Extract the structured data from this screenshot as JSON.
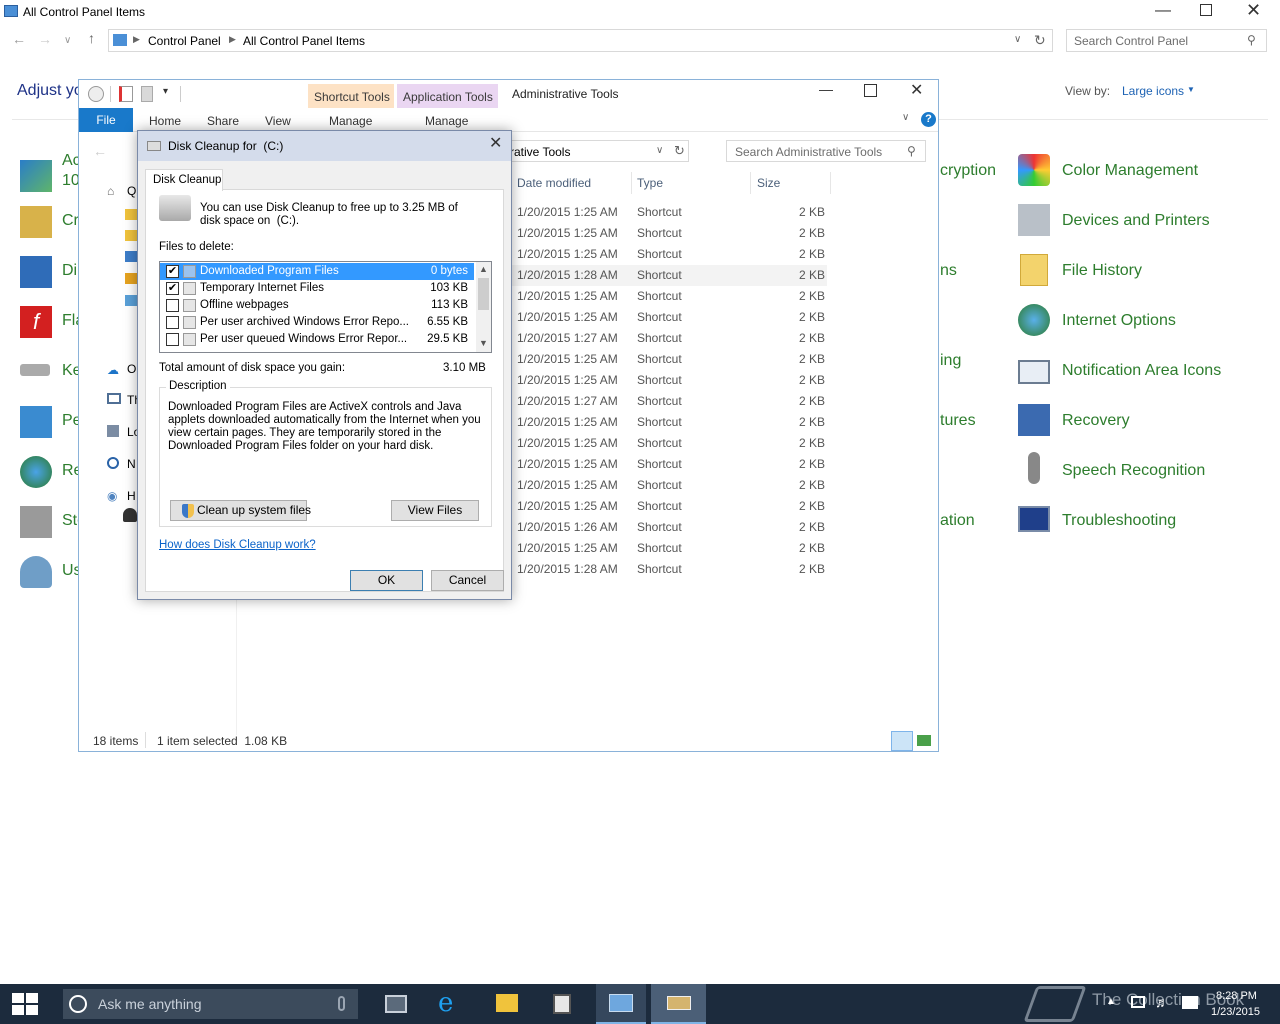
{
  "control_panel": {
    "window_title": "All Control Panel Items",
    "breadcrumb": [
      "Control Panel",
      "All Control Panel Items"
    ],
    "search_placeholder": "Search Control Panel",
    "adjust_heading": "Adjust yo",
    "view_by_label": "View by:",
    "view_by_value": "Large icons",
    "left_items": [
      "Ac",
      "10",
      "Cr",
      "Di",
      "Fla",
      "Ke",
      "Pe",
      "Re",
      "Sto",
      "Us"
    ],
    "middle_fragments": [
      "cryption",
      "ns",
      "ing",
      "tures",
      "ation"
    ],
    "right_items": [
      "Color Management",
      "Devices and Printers",
      "File History",
      "Internet Options",
      "Notification Area Icons",
      "Recovery",
      "Speech Recognition",
      "Troubleshooting"
    ]
  },
  "admin_tools": {
    "title": "Administrative Tools",
    "context_tabs": [
      {
        "group": "Shortcut Tools",
        "label": "Manage",
        "color": "#fde2c5"
      },
      {
        "group": "Application Tools",
        "label": "Manage",
        "color": "#ead6f2"
      }
    ],
    "ribbon_tabs": [
      "File",
      "Home",
      "Share",
      "View"
    ],
    "address_fragment": "rative Tools",
    "search_placeholder": "Search Administrative Tools",
    "columns": [
      "Date modified",
      "Type",
      "Size"
    ],
    "rows": [
      {
        "date": "1/20/2015 1:25 AM",
        "type": "Shortcut",
        "size": "2 KB"
      },
      {
        "date": "1/20/2015 1:25 AM",
        "type": "Shortcut",
        "size": "2 KB"
      },
      {
        "date": "1/20/2015 1:25 AM",
        "type": "Shortcut",
        "size": "2 KB"
      },
      {
        "date": "1/20/2015 1:28 AM",
        "type": "Shortcut",
        "size": "2 KB"
      },
      {
        "date": "1/20/2015 1:25 AM",
        "type": "Shortcut",
        "size": "2 KB"
      },
      {
        "date": "1/20/2015 1:25 AM",
        "type": "Shortcut",
        "size": "2 KB"
      },
      {
        "date": "1/20/2015 1:27 AM",
        "type": "Shortcut",
        "size": "2 KB"
      },
      {
        "date": "1/20/2015 1:25 AM",
        "type": "Shortcut",
        "size": "2 KB"
      },
      {
        "date": "1/20/2015 1:25 AM",
        "type": "Shortcut",
        "size": "2 KB"
      },
      {
        "date": "1/20/2015 1:27 AM",
        "type": "Shortcut",
        "size": "2 KB"
      },
      {
        "date": "1/20/2015 1:25 AM",
        "type": "Shortcut",
        "size": "2 KB"
      },
      {
        "date": "1/20/2015 1:25 AM",
        "type": "Shortcut",
        "size": "2 KB"
      },
      {
        "date": "1/20/2015 1:25 AM",
        "type": "Shortcut",
        "size": "2 KB"
      },
      {
        "date": "1/20/2015 1:25 AM",
        "type": "Shortcut",
        "size": "2 KB"
      },
      {
        "date": "1/20/2015 1:25 AM",
        "type": "Shortcut",
        "size": "2 KB"
      },
      {
        "date": "1/20/2015 1:26 AM",
        "type": "Shortcut",
        "size": "2 KB"
      },
      {
        "date": "1/20/2015 1:25 AM",
        "type": "Shortcut",
        "size": "2 KB"
      },
      {
        "date": "1/20/2015 1:28 AM",
        "type": "Shortcut",
        "size": "2 KB"
      }
    ],
    "nav_fragments": [
      "Q",
      "O",
      "Th",
      "Lo",
      "N",
      "H"
    ],
    "status_count": "18 items",
    "status_selected": "1 item selected  1.08 KB"
  },
  "disk_cleanup": {
    "title": "Disk Cleanup for  (C:)",
    "tab": "Disk Cleanup",
    "intro": "You can use Disk Cleanup to free up to 3.25 MB of disk space on  (C:).",
    "files_label": "Files to delete:",
    "files": [
      {
        "name": "Downloaded Program Files",
        "size": "0 bytes",
        "checked": true,
        "selected": true
      },
      {
        "name": "Temporary Internet Files",
        "size": "103 KB",
        "checked": true,
        "selected": false
      },
      {
        "name": "Offline webpages",
        "size": "113 KB",
        "checked": false,
        "selected": false
      },
      {
        "name": "Per user archived Windows Error Repo...",
        "size": "6.55 KB",
        "checked": false,
        "selected": false
      },
      {
        "name": "Per user queued Windows Error Repor...",
        "size": "29.5 KB",
        "checked": false,
        "selected": false
      }
    ],
    "total_label": "Total amount of disk space you gain:",
    "total_value": "3.10 MB",
    "description_label": "Description",
    "description": "Downloaded Program Files are ActiveX controls and Java applets downloaded automatically from the Internet when you view certain pages. They are temporarily stored in the Downloaded Program Files folder on your hard disk.",
    "cleanup_system_button": "Clean up system files",
    "view_files_button": "View Files",
    "help_link": "How does Disk Cleanup work?",
    "ok_button": "OK",
    "cancel_button": "Cancel"
  },
  "taskbar": {
    "search_placeholder": "Ask me anything",
    "time": "8:28 PM",
    "date": "1/23/2015",
    "watermark": "The Collection Book"
  }
}
